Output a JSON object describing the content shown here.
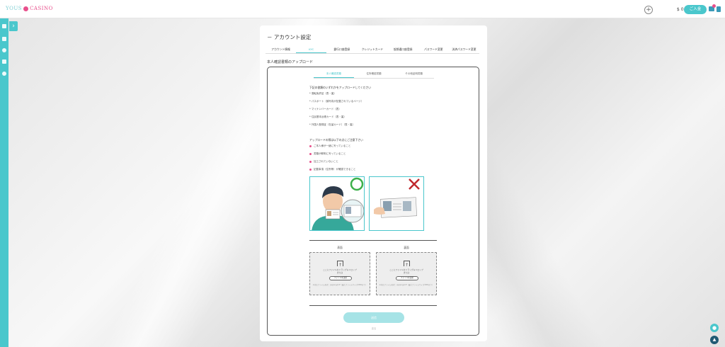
{
  "header": {
    "logo_left": "YOUS",
    "logo_right": "CASINO",
    "balance": "$ 0",
    "deposit_label": "ご入金"
  },
  "page": {
    "title": "－ アカウント設定",
    "tabs": [
      {
        "label": "アカウント情報"
      },
      {
        "label": "KYC",
        "active": true
      },
      {
        "label": "銀行口座登録"
      },
      {
        "label": "クレジットカード"
      },
      {
        "label": "仮想通口座登録"
      },
      {
        "label": "パスワード変更"
      },
      {
        "label": "決済パスワード変更"
      }
    ],
    "section_title": "本人確認書類のアップロード"
  },
  "kyc": {
    "subtabs": [
      {
        "label": "本人確認書類",
        "active": true
      },
      {
        "label": "住所確認書類"
      },
      {
        "label": "その他証明書類"
      }
    ],
    "doc_heading": "下記の書類のいずれかをアップロードしてください",
    "docs": [
      "* 運転免許証（表・裏）",
      "* パスポート（顔写真が記載されているページ）",
      "* マイナンバーカード（表）",
      "* 住民基本台帳カード（表・裏）",
      "* 外国人登録証（在留カード）（表・裏）"
    ],
    "req_heading": "アップロードの際は以下の点にご注意下さい",
    "requirements": [
      "ご本人様が一緒に写っていること",
      "書類が鮮明に写っていること",
      "加工されていないこと",
      "記載事項（住所等）が確認できること"
    ],
    "upload": {
      "front_label": "表面",
      "back_label": "裏面",
      "drop_text_1": "ここにファイルをドラッグ＆ドロップ",
      "drop_text_2": "または",
      "file_button": "ファイルを選択",
      "format_text": "※対応ファイル形式：jpg/png/pdf（最大ファイルサイズ5MBまで）"
    },
    "submit_label": "送信",
    "back_label": "戻る"
  }
}
